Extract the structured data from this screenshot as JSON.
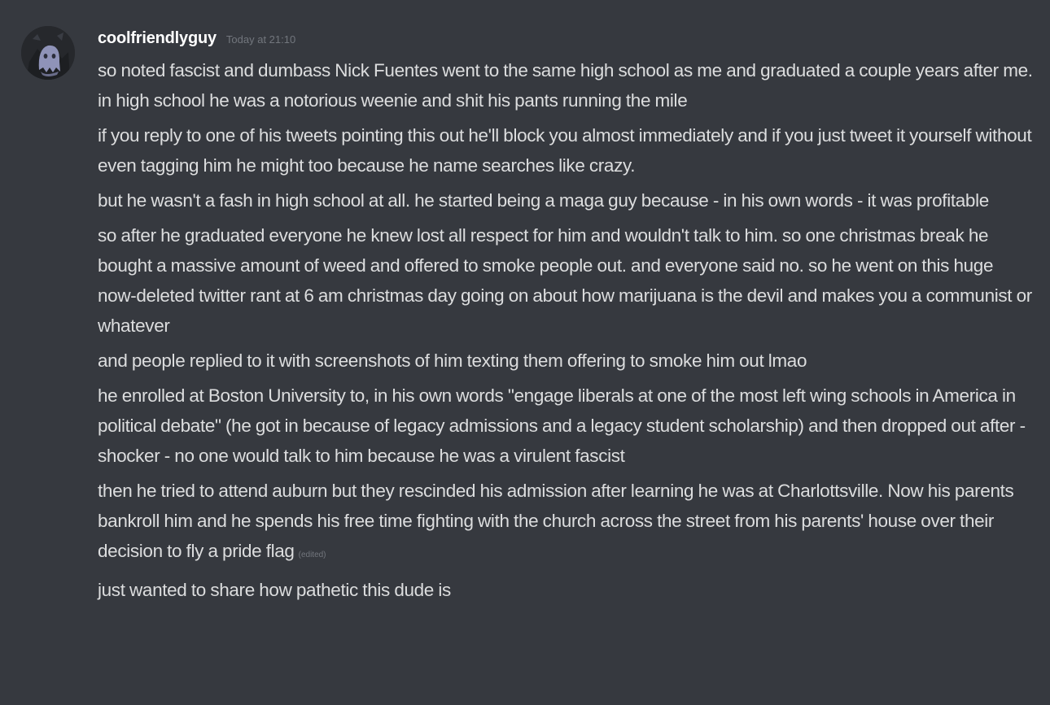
{
  "author": {
    "username": "coolfriendlyguy",
    "timestamp": "Today at 21:10",
    "avatar_icon": "ghost-avatar-icon"
  },
  "messages": [
    {
      "text": "so noted fascist and dumbass Nick Fuentes went to the same high school as me and graduated a couple years after me. in high school he was a notorious weenie and shit his pants running the mile"
    },
    {
      "text": "if you reply to one of his tweets pointing this out he'll block you almost immediately and if you just tweet it yourself without even tagging him he might too because he name searches like crazy."
    },
    {
      "text": "but he wasn't a fash in high school at all. he started being a maga guy because - in his own words - it was profitable"
    },
    {
      "text": "so after he graduated everyone he knew lost all respect for him and wouldn't talk to him. so one christmas break he bought a massive amount of weed and offered to smoke people out. and everyone said no. so he went on this huge now-deleted twitter rant at 6 am christmas day going on about how marijuana is the devil and makes you a communist or whatever"
    },
    {
      "text": "and people replied to it with screenshots of him texting them offering to smoke him out lmao"
    },
    {
      "text": "he enrolled at Boston University to, in his own words \"engage liberals at one of the most left wing schools in America in political debate\" (he got in because of legacy admissions and a legacy student scholarship) and then dropped out after - shocker - no one would talk to him because he was a virulent fascist"
    },
    {
      "text": "then he tried to attend auburn but they rescinded his admission after learning he was at Charlottsville. Now his parents bankroll him and he spends his free time fighting with the church across the street from his parents' house over their decision to fly a pride flag",
      "edited": "(edited)"
    },
    {
      "text": "just wanted to share how pathetic this dude is"
    }
  ],
  "colors": {
    "background": "#36393f",
    "username": "#ffffff",
    "message_text": "#dcddde",
    "muted": "#72767d"
  }
}
